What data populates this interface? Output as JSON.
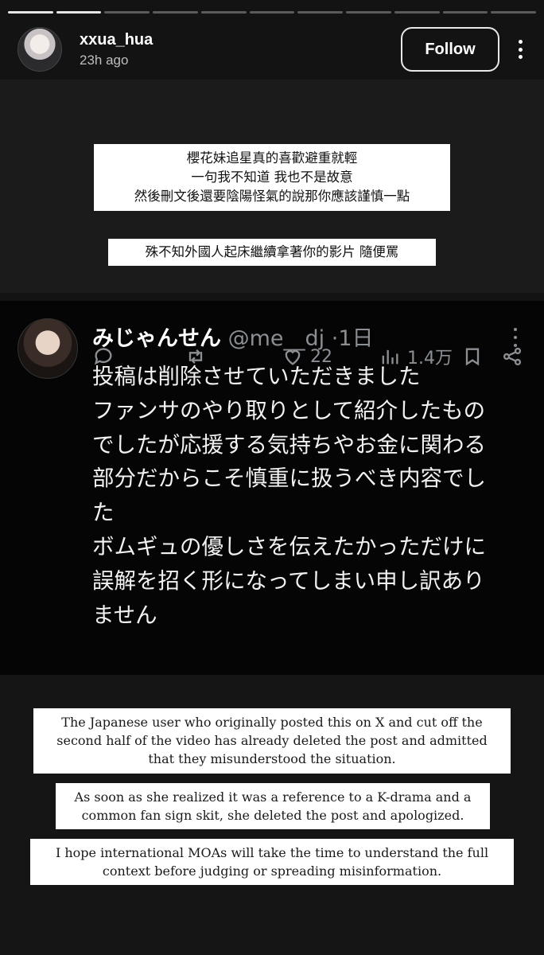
{
  "progress": {
    "segments": 11,
    "completed": 2
  },
  "header": {
    "username": "xxua_hua",
    "time": "23h ago",
    "follow_label": "Follow"
  },
  "captions_top": [
    [
      "櫻花妹追星真的喜歡避重就輕",
      "一句我不知道 我也不是故意",
      "然後刪文後還要陰陽怪氣的說那你應該謹慎一點"
    ],
    [
      "殊不知外國人起床繼續拿著你的影片 隨便罵"
    ]
  ],
  "tweet": {
    "name": "みじゃんせん",
    "handle": "@me__dj",
    "time": "1日",
    "lines": [
      "投稿は削除させていただきました",
      "ファンサのやり取りとして紹介したもの",
      "でしたが応援する気持ちやお金に関わる",
      "部分だからこそ慎重に扱うべき内容でし",
      "た",
      "ボムギュの優しさを伝えたかっただけに",
      "誤解を招く形になってしまい申し訳あり",
      "ません"
    ],
    "likes": "22",
    "views": "1.4万",
    "icons": [
      "reply-icon",
      "retweet-icon",
      "heart-icon",
      "views-icon",
      "bookmark-icon",
      "share-icon"
    ]
  },
  "captions_bottom": [
    [
      "The Japanese user who originally posted this on X and cut off the",
      "second half of the video has already deleted the post and admitted",
      "that they misunderstood the situation."
    ],
    [
      "As soon as she realized it was a reference to a K-drama and a",
      "common fan sign skit, she deleted the post and apologized."
    ],
    [
      "I hope international MOAs will take the time to understand the full",
      "context before judging or spreading misinformation."
    ]
  ]
}
